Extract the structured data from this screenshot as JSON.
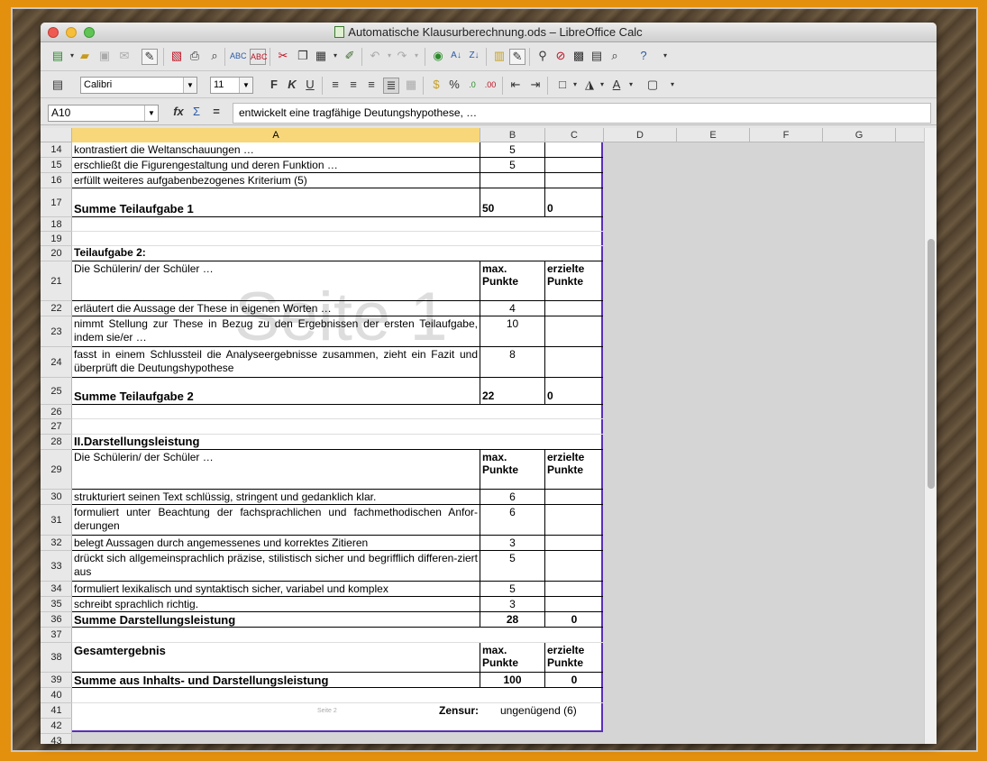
{
  "window": {
    "title": "Automatische Klausurberechnung.ods – LibreOffice Calc"
  },
  "format_bar": {
    "font": "Calibri",
    "size": "11"
  },
  "formula_bar": {
    "cell_ref": "A10",
    "content": "entwickelt eine tragfähige Deutungshypothese, …"
  },
  "columns": [
    "A",
    "B",
    "C",
    "D",
    "E",
    "F",
    "G"
  ],
  "page_watermark": "Seite 1",
  "rows": [
    {
      "n": "14",
      "a": "kontrastiert die Weltanschauungen …",
      "b": "5",
      "c": ""
    },
    {
      "n": "15",
      "a": "erschließt die Figurengestaltung und deren Funktion …",
      "b": "5",
      "c": ""
    },
    {
      "n": "16",
      "a": "erfüllt weiteres aufgabenbezogenes Kriterium (5)",
      "b": "",
      "c": ""
    },
    {
      "n": "17",
      "a": "Summe Teilaufgabe 1",
      "b": "50",
      "c": "0"
    },
    {
      "n": "18",
      "a": "",
      "b": "",
      "c": ""
    },
    {
      "n": "19",
      "a": "",
      "b": "",
      "c": ""
    },
    {
      "n": "20",
      "a": "Teilaufgabe 2:",
      "b": "",
      "c": ""
    },
    {
      "n": "21",
      "a": "Die Schülerin/ der Schüler …",
      "b": "max. Punkte",
      "c": "erzielte Punkte"
    },
    {
      "n": "22",
      "a": "erläutert die Aussage der These in eigenen Worten …",
      "b": "4",
      "c": ""
    },
    {
      "n": "23",
      "a": "nimmt Stellung zur These in Bezug zu den Ergebnissen der ersten Teilaufgabe, indem sie/er …",
      "b": "10",
      "c": ""
    },
    {
      "n": "24",
      "a": "fasst in einem Schlussteil die Analyseergebnisse zusammen, zieht ein Fazit und überprüft die Deutungshypothese",
      "b": "8",
      "c": ""
    },
    {
      "n": "25",
      "a": "Summe Teilaufgabe 2",
      "b": "22",
      "c": "0"
    },
    {
      "n": "26",
      "a": "",
      "b": "",
      "c": ""
    },
    {
      "n": "27",
      "a": "",
      "b": "",
      "c": ""
    },
    {
      "n": "28",
      "a": "II.Darstellungsleistung",
      "b": "",
      "c": ""
    },
    {
      "n": "29",
      "a": "Die Schülerin/ der Schüler …",
      "b": "max. Punkte",
      "c": "erzielte Punkte"
    },
    {
      "n": "30",
      "a": "strukturiert seinen Text schlüssig, stringent und gedanklich klar.",
      "b": "6",
      "c": ""
    },
    {
      "n": "31",
      "a": "formuliert unter Beachtung der fachsprachlichen und fachmethodischen Anfor-derungen",
      "b": "6",
      "c": ""
    },
    {
      "n": "32",
      "a": "belegt Aussagen durch angemessenes und korrektes Zitieren",
      "b": "3",
      "c": ""
    },
    {
      "n": "33",
      "a": "drückt sich allgemeinsprachlich präzise, stilistisch sicher und begrifflich differen-ziert aus",
      "b": "5",
      "c": ""
    },
    {
      "n": "34",
      "a": "formuliert lexikalisch und syntaktisch sicher, variabel und komplex",
      "b": "5",
      "c": ""
    },
    {
      "n": "35",
      "a": "schreibt sprachlich richtig.",
      "b": "3",
      "c": ""
    },
    {
      "n": "36",
      "a": "Summe Darstellungsleistung",
      "b": "28",
      "c": "0"
    },
    {
      "n": "37",
      "a": "",
      "b": "",
      "c": ""
    },
    {
      "n": "38",
      "a": "Gesamtergebnis",
      "b": "max. Punkte",
      "c": "erzielte Punkte"
    },
    {
      "n": "39",
      "a": "Summe aus Inhalts- und Darstellungsleistung",
      "b": "100",
      "c": "0"
    },
    {
      "n": "40",
      "a": "",
      "b": "",
      "c": ""
    },
    {
      "n": "41",
      "a": "Zensur:",
      "b": "ungenügend (6)",
      "c": ""
    },
    {
      "n": "42",
      "a": "",
      "b": "",
      "c": ""
    },
    {
      "n": "43",
      "a": "",
      "b": "",
      "c": ""
    }
  ],
  "footer_page_label": "Seite 2"
}
